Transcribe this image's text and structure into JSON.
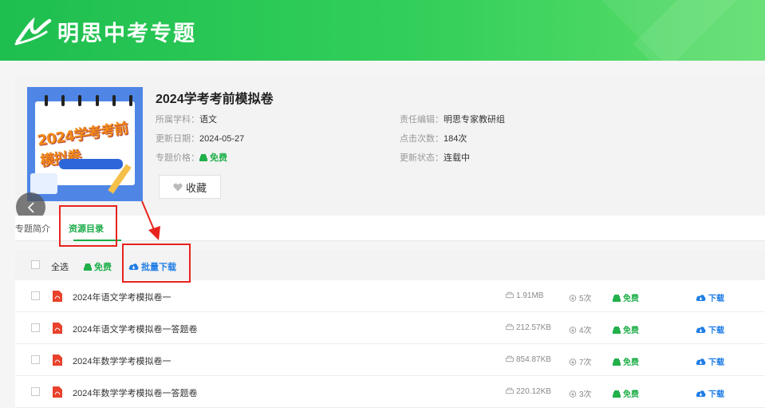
{
  "header": {
    "brand": "明思中考专题"
  },
  "topic": {
    "title": "2024学考考前模拟卷",
    "cover_title": "2024学考考前模拟卷",
    "subject_label": "所属学科：",
    "subject": "语文",
    "editor_label": "责任编辑：",
    "editor": "明思专家教研组",
    "updated_label": "更新日期：",
    "updated": "2024-05-27",
    "clicks_label": "点击次数：",
    "clicks": "184次",
    "price_label": "专题价格：",
    "price": "免费",
    "status_label": "更新状态：",
    "status": "连载中",
    "favorite_label": "收藏"
  },
  "tabs": [
    {
      "label": "专题简介"
    },
    {
      "label": "资源目录"
    }
  ],
  "toolbar": {
    "select_all": "全选",
    "free": "免费",
    "batch_download": "批量下载"
  },
  "files": [
    {
      "name": "2024年语文学考模拟卷一",
      "size": "1.91MB",
      "downloads": "5次",
      "price": "免费",
      "action": "下载"
    },
    {
      "name": "2024年语文学考模拟卷一答题卷",
      "size": "212.57KB",
      "downloads": "4次",
      "price": "免费",
      "action": "下载"
    },
    {
      "name": "2024年数学学考模拟卷一",
      "size": "854.87KB",
      "downloads": "7次",
      "price": "免费",
      "action": "下载"
    },
    {
      "name": "2024年数学学考模拟卷一答题卷",
      "size": "220.12KB",
      "downloads": "3次",
      "price": "免费",
      "action": "下载"
    }
  ],
  "colors": {
    "brand_green": "#1ebe4f",
    "accent_blue": "#1f7de6",
    "annotation_red": "#e8231e"
  },
  "icons": [
    "logo-icon",
    "heart-icon",
    "chevron-left-icon",
    "pdf-icon",
    "disk-icon",
    "download-count-icon",
    "coin-icon",
    "cloud-download-icon"
  ]
}
